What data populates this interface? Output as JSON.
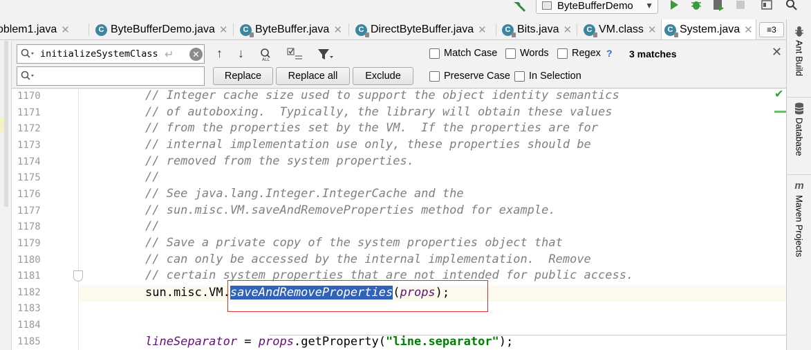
{
  "toolbar": {
    "run_config": "ByteBufferDemo",
    "icons": [
      "build-hammer-icon",
      "run-icon",
      "debug-icon",
      "coverage-icon",
      "stop-icon",
      "project-structure-icon",
      "search-everywhere-icon"
    ]
  },
  "tabs": [
    {
      "label": "oblem1.java",
      "icon": "class-icon",
      "active": false
    },
    {
      "label": "ByteBufferDemo.java",
      "icon": "class-icon",
      "active": false
    },
    {
      "label": "ByteBuffer.java",
      "icon": "library-class-icon",
      "active": false
    },
    {
      "label": "DirectByteBuffer.java",
      "icon": "library-class-icon",
      "active": false
    },
    {
      "label": "Bits.java",
      "icon": "library-class-icon",
      "active": false
    },
    {
      "label": "VM.class",
      "icon": "library-class-icon",
      "active": false
    },
    {
      "label": "System.java",
      "icon": "library-class-icon",
      "active": true
    }
  ],
  "tab_overflow": "≡3",
  "find": {
    "search_value": "initializeSystemClass",
    "replace_value": "",
    "replace_button": "Replace",
    "replace_all_button": "Replace all",
    "exclude_button": "Exclude",
    "match_case": "Match Case",
    "words": "Words",
    "regex": "Regex",
    "help": "?",
    "preserve_case": "Preserve Case",
    "in_selection": "In Selection",
    "matches": "3 matches"
  },
  "editor": {
    "lines": [
      {
        "num": "1170",
        "text": "// Integer cache size used to support the object identity semantics",
        "kind": "comment"
      },
      {
        "num": "1171",
        "text": "// of autoboxing.  Typically, the library will obtain these values",
        "kind": "comment"
      },
      {
        "num": "1172",
        "text": "// from the properties set by the VM.  If the properties are for",
        "kind": "comment"
      },
      {
        "num": "1173",
        "text": "// internal implementation use only, these properties should be",
        "kind": "comment"
      },
      {
        "num": "1174",
        "text": "// removed from the system properties.",
        "kind": "comment"
      },
      {
        "num": "1175",
        "text": "//",
        "kind": "comment"
      },
      {
        "num": "1176",
        "text": "// See java.lang.Integer.IntegerCache and the",
        "kind": "comment"
      },
      {
        "num": "1177",
        "text": "// sun.misc.VM.saveAndRemoveProperties method for example.",
        "kind": "comment"
      },
      {
        "num": "1178",
        "text": "//",
        "kind": "comment"
      },
      {
        "num": "1179",
        "text": "// Save a private copy of the system properties object that",
        "kind": "comment"
      },
      {
        "num": "1180",
        "text": "// can only be accessed by the internal implementation.  Remove",
        "kind": "comment"
      },
      {
        "num": "1181",
        "text": "// certain system properties that are not intended for public access.",
        "kind": "comment"
      },
      {
        "num": "1182",
        "text": "",
        "kind": "code"
      },
      {
        "num": "1183",
        "text": "",
        "kind": "code"
      },
      {
        "num": "1184",
        "text": "",
        "kind": "code"
      },
      {
        "num": "1185",
        "text": "",
        "kind": "code"
      }
    ],
    "call_line": {
      "prefix": "sun.misc.VM.",
      "method": "saveAndRemoveProperties",
      "open": "(",
      "arg": "props",
      "close": ");"
    },
    "last_line": {
      "field": "lineSeparator",
      "assign": " = ",
      "obj": "props",
      "call": ".getProperty(",
      "str": "\"line.separator\"",
      "close": ");"
    }
  },
  "side_tools": [
    {
      "label": "Ant Build",
      "icon": "ant-icon"
    },
    {
      "label": "Database",
      "icon": "database-icon"
    },
    {
      "label": "Maven Projects",
      "icon": "maven-icon"
    }
  ]
}
